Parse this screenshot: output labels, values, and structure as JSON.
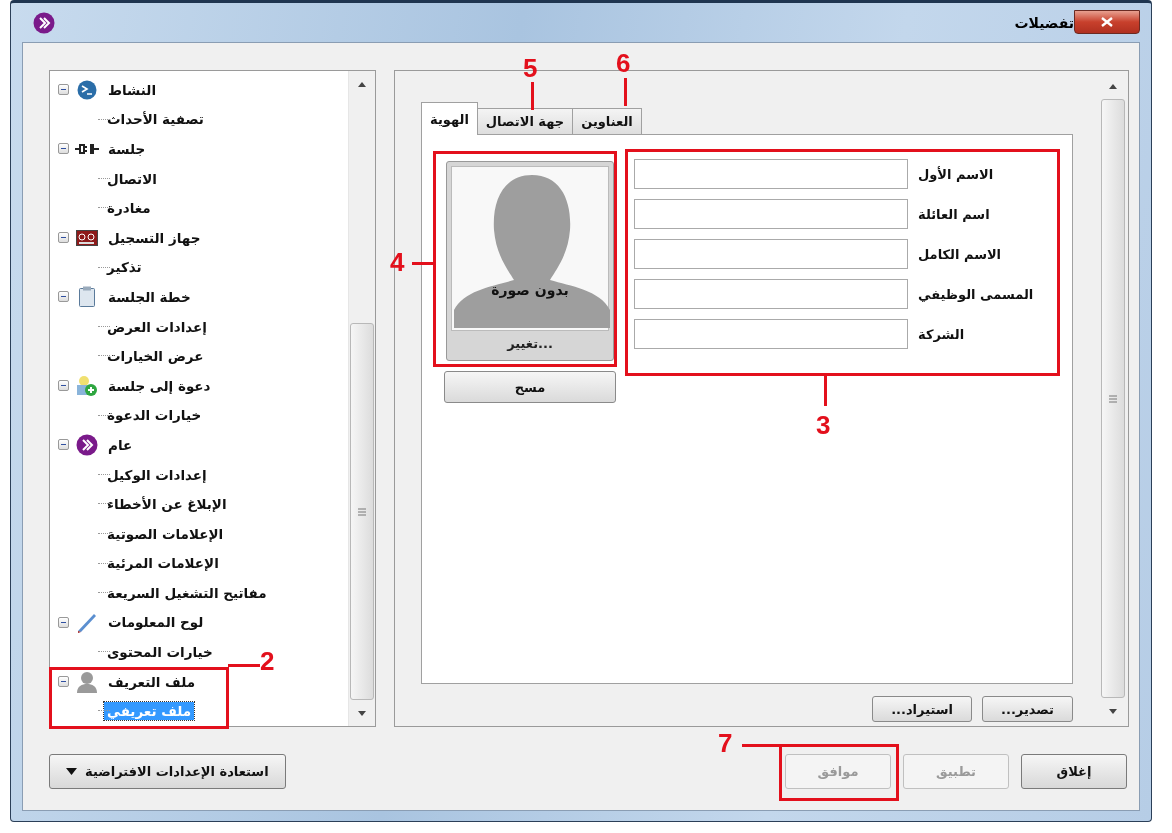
{
  "window": {
    "title": "تفضيلات"
  },
  "tree": [
    {
      "label": "النشاط",
      "expanded": true,
      "selected": false,
      "children": [
        {
          "label": "تصفية الأحداث",
          "selected": false
        }
      ]
    },
    {
      "label": "جلسة",
      "expanded": true,
      "selected": false,
      "children": [
        {
          "label": "الاتصال",
          "selected": false
        },
        {
          "label": "مغادرة",
          "selected": false
        }
      ]
    },
    {
      "label": "جهاز التسجيل",
      "expanded": true,
      "selected": false,
      "children": [
        {
          "label": "تذكير",
          "selected": false
        }
      ]
    },
    {
      "label": "خطة الجلسة",
      "expanded": true,
      "selected": false,
      "children": [
        {
          "label": "إعدادات العرض",
          "selected": false
        },
        {
          "label": "عرض الخيارات",
          "selected": false
        }
      ]
    },
    {
      "label": "دعوة إلى جلسة",
      "expanded": true,
      "selected": false,
      "children": [
        {
          "label": "خيارات الدعوة",
          "selected": false
        }
      ]
    },
    {
      "label": "عام",
      "expanded": true,
      "selected": false,
      "children": [
        {
          "label": "إعدادات الوكيل",
          "selected": false
        },
        {
          "label": "الإبلاغ عن الأخطاء",
          "selected": false
        },
        {
          "label": "الإعلامات الصوتية",
          "selected": false
        },
        {
          "label": "الإعلامات المرئية",
          "selected": false
        },
        {
          "label": "مفاتيح التشغيل السريعة",
          "selected": false
        }
      ]
    },
    {
      "label": "لوح المعلومات",
      "expanded": true,
      "selected": false,
      "children": [
        {
          "label": "خيارات المحتوى",
          "selected": false
        }
      ]
    },
    {
      "label": "ملف التعريف",
      "expanded": true,
      "selected": false,
      "children": [
        {
          "label": "ملف تعريفي",
          "selected": true
        }
      ]
    }
  ],
  "tabs": [
    {
      "label": "العناوين",
      "selected": false
    },
    {
      "label": "جهة الاتصال",
      "selected": false
    },
    {
      "label": "الهوية",
      "selected": true
    }
  ],
  "photo": {
    "caption": "بدون صورة",
    "change_button": "تغيير...",
    "clear_button": "مسح"
  },
  "fields": [
    {
      "label": "الاسم الأول"
    },
    {
      "label": "اسم العائلة"
    },
    {
      "label": "الاسم الكامل"
    },
    {
      "label": "المسمى الوظيفي"
    },
    {
      "label": "الشركة"
    }
  ],
  "panel_buttons": [
    "تصدير...",
    "استيراد..."
  ],
  "restore_button": "استعادة الإعدادات الافتراضية",
  "dialog_buttons": [
    {
      "label": "إغلاق",
      "disabled": false
    },
    {
      "label": "تطبيق",
      "disabled": true
    },
    {
      "label": "موافق",
      "disabled": true
    }
  ],
  "annotations": [
    {
      "label": "2"
    },
    {
      "label": "3"
    },
    {
      "label": "4"
    },
    {
      "label": "5"
    },
    {
      "label": "6"
    },
    {
      "label": "7"
    }
  ]
}
